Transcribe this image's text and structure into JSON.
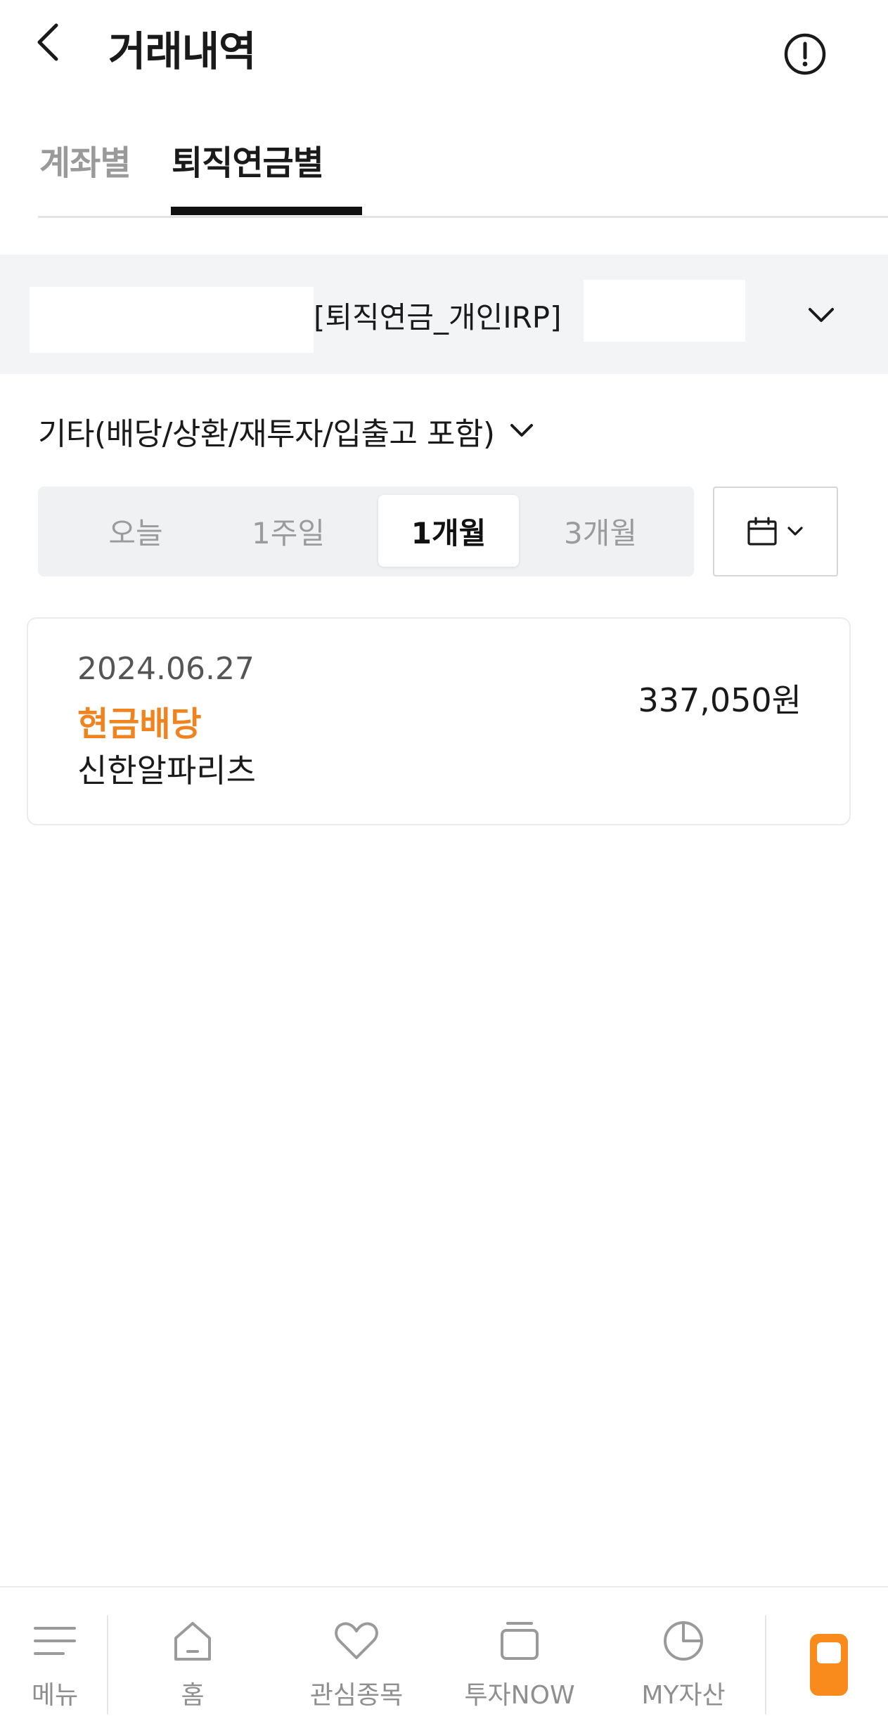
{
  "header": {
    "title": "거래내역",
    "back_icon": "chevron-left-icon",
    "info_icon": "info-circle-icon"
  },
  "tabs": [
    {
      "label": "계좌별",
      "active": false
    },
    {
      "label": "퇴직연금별",
      "active": true
    }
  ],
  "account": {
    "name": "[퇴직연금_개인IRP]"
  },
  "filter": {
    "label": "기타(배당/상환/재투자/입출고 포함)"
  },
  "periods": [
    {
      "label": "오늘",
      "selected": false
    },
    {
      "label": "1주일",
      "selected": false
    },
    {
      "label": "1개월",
      "selected": true
    },
    {
      "label": "3개월",
      "selected": false
    }
  ],
  "date_picker_icon": "calendar-icon",
  "transactions": [
    {
      "date": "2024.06.27",
      "type": "현금배당",
      "item": "신한알파리츠",
      "amount": "337,050원"
    }
  ],
  "bottom_nav": [
    {
      "label": "메뉴",
      "icon": "menu-icon"
    },
    {
      "label": "홈",
      "icon": "home-icon"
    },
    {
      "label": "관심종목",
      "icon": "heart-icon"
    },
    {
      "label": "투자NOW",
      "icon": "stack-icon"
    },
    {
      "label": "MY자산",
      "icon": "pie-chart-icon"
    }
  ],
  "colors": {
    "accent": "#f0831e",
    "nav_special": "#f98a1c",
    "account_bar_bg": "#f3f4f6"
  }
}
